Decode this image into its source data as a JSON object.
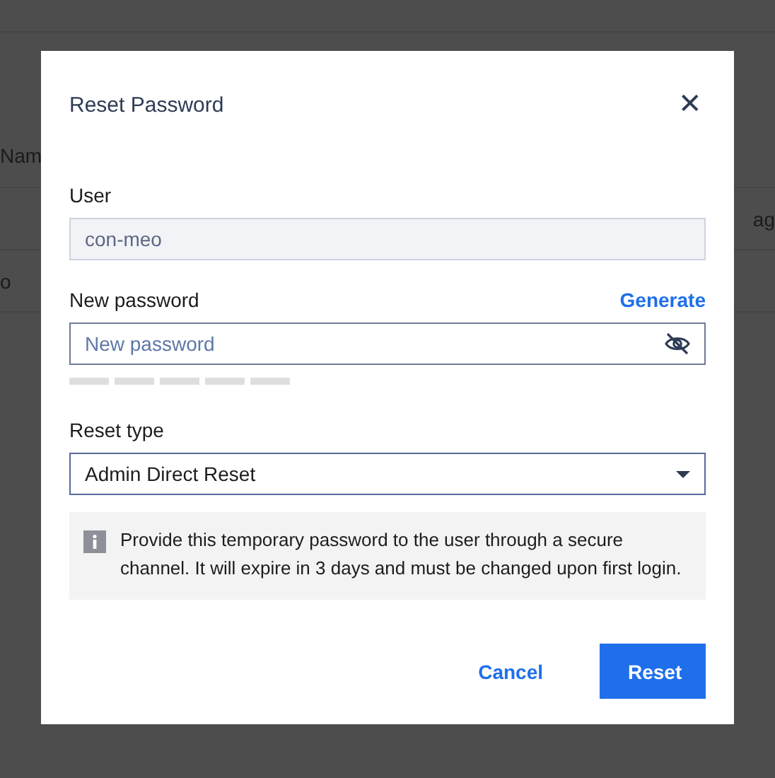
{
  "background": {
    "header_text": "Nam",
    "row_texts": [
      "ag",
      "o"
    ]
  },
  "dialog": {
    "title": "Reset Password",
    "close_icon": "✕",
    "user": {
      "label": "User",
      "value": "con-meo",
      "disabled": true
    },
    "new_password": {
      "label": "New password",
      "action": "Generate",
      "placeholder": "New password",
      "strength": {
        "level": 0
      }
    },
    "reset_type": {
      "label": "Reset type",
      "value": "Admin Direct Reset"
    },
    "info": "Provide this temporary password to the user through a secure channel. It will expire in 3 days and must be changed upon first login.",
    "buttons": [
      {
        "label": "Cancel",
        "kind": "secondary"
      },
      {
        "label": "Reset",
        "kind": "primary"
      }
    ]
  }
}
